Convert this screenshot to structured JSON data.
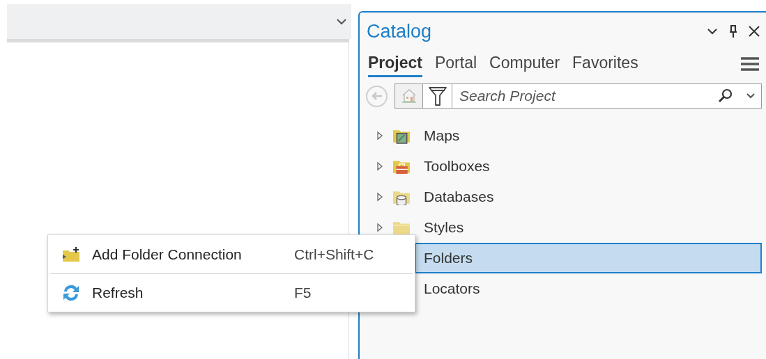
{
  "catalog": {
    "title": "Catalog",
    "tabs": [
      {
        "label": "Project",
        "selected": true
      },
      {
        "label": "Portal",
        "selected": false
      },
      {
        "label": "Computer",
        "selected": false
      },
      {
        "label": "Favorites",
        "selected": false
      }
    ],
    "search": {
      "placeholder": "Search Project"
    },
    "tree": [
      {
        "label": "Maps",
        "kind": "maps",
        "expandable": true,
        "selected": false
      },
      {
        "label": "Toolboxes",
        "kind": "toolboxes",
        "expandable": true,
        "selected": false
      },
      {
        "label": "Databases",
        "kind": "databases",
        "expandable": true,
        "selected": false
      },
      {
        "label": "Styles",
        "kind": "folder",
        "expandable": true,
        "selected": false
      },
      {
        "label": "Folders",
        "expandable": false,
        "selected": true
      },
      {
        "label": "Locators",
        "expandable": false,
        "selected": false
      }
    ]
  },
  "context_menu": [
    {
      "label": "Add Folder Connection",
      "shortcut": "Ctrl+Shift+C",
      "kind": "add-folder"
    },
    {
      "label": "Refresh",
      "shortcut": "F5",
      "kind": "refresh"
    }
  ]
}
